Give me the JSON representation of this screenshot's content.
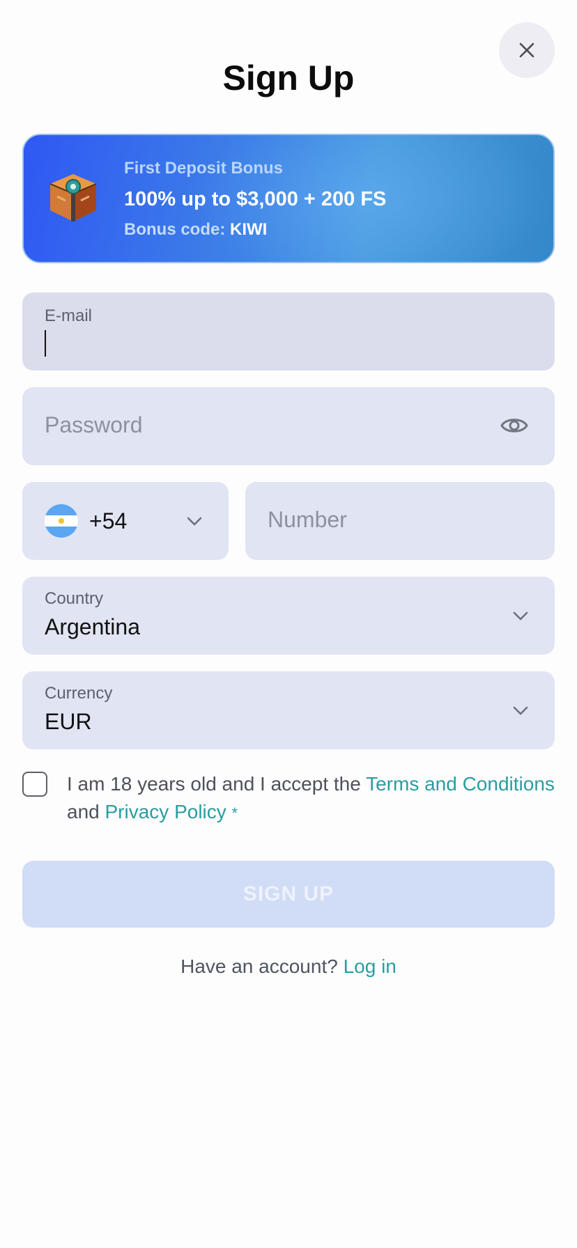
{
  "header": {
    "title": "Sign Up",
    "close_icon": "close-icon"
  },
  "bonus": {
    "label": "First Deposit Bonus",
    "offer": "100% up to $3,000 + 200 FS",
    "code_prefix": "Bonus code:",
    "code": "KIWI",
    "icon": "treasure-chest-icon"
  },
  "form": {
    "email": {
      "label": "E-mail",
      "value": ""
    },
    "password": {
      "placeholder": "Password",
      "icon": "eye-icon"
    },
    "phone": {
      "country_flag": "argentina-flag-icon",
      "code": "+54",
      "number_placeholder": "Number"
    },
    "country": {
      "label": "Country",
      "value": "Argentina"
    },
    "currency": {
      "label": "Currency",
      "value": "EUR"
    },
    "terms": {
      "text_before": "I am 18 years old and I accept the",
      "terms_link": "Terms and Conditions",
      "and": "and",
      "privacy_link": "Privacy Policy",
      "required_mark": "*"
    },
    "submit_label": "SIGN UP"
  },
  "footer": {
    "question": "Have an account?",
    "login_link": "Log in"
  },
  "colors": {
    "accent_link": "#2a9d9f",
    "field_bg": "#e0e4f3",
    "button_disabled": "#d1dcf6",
    "banner_start": "#2f58f3",
    "banner_end": "#3388c9"
  }
}
